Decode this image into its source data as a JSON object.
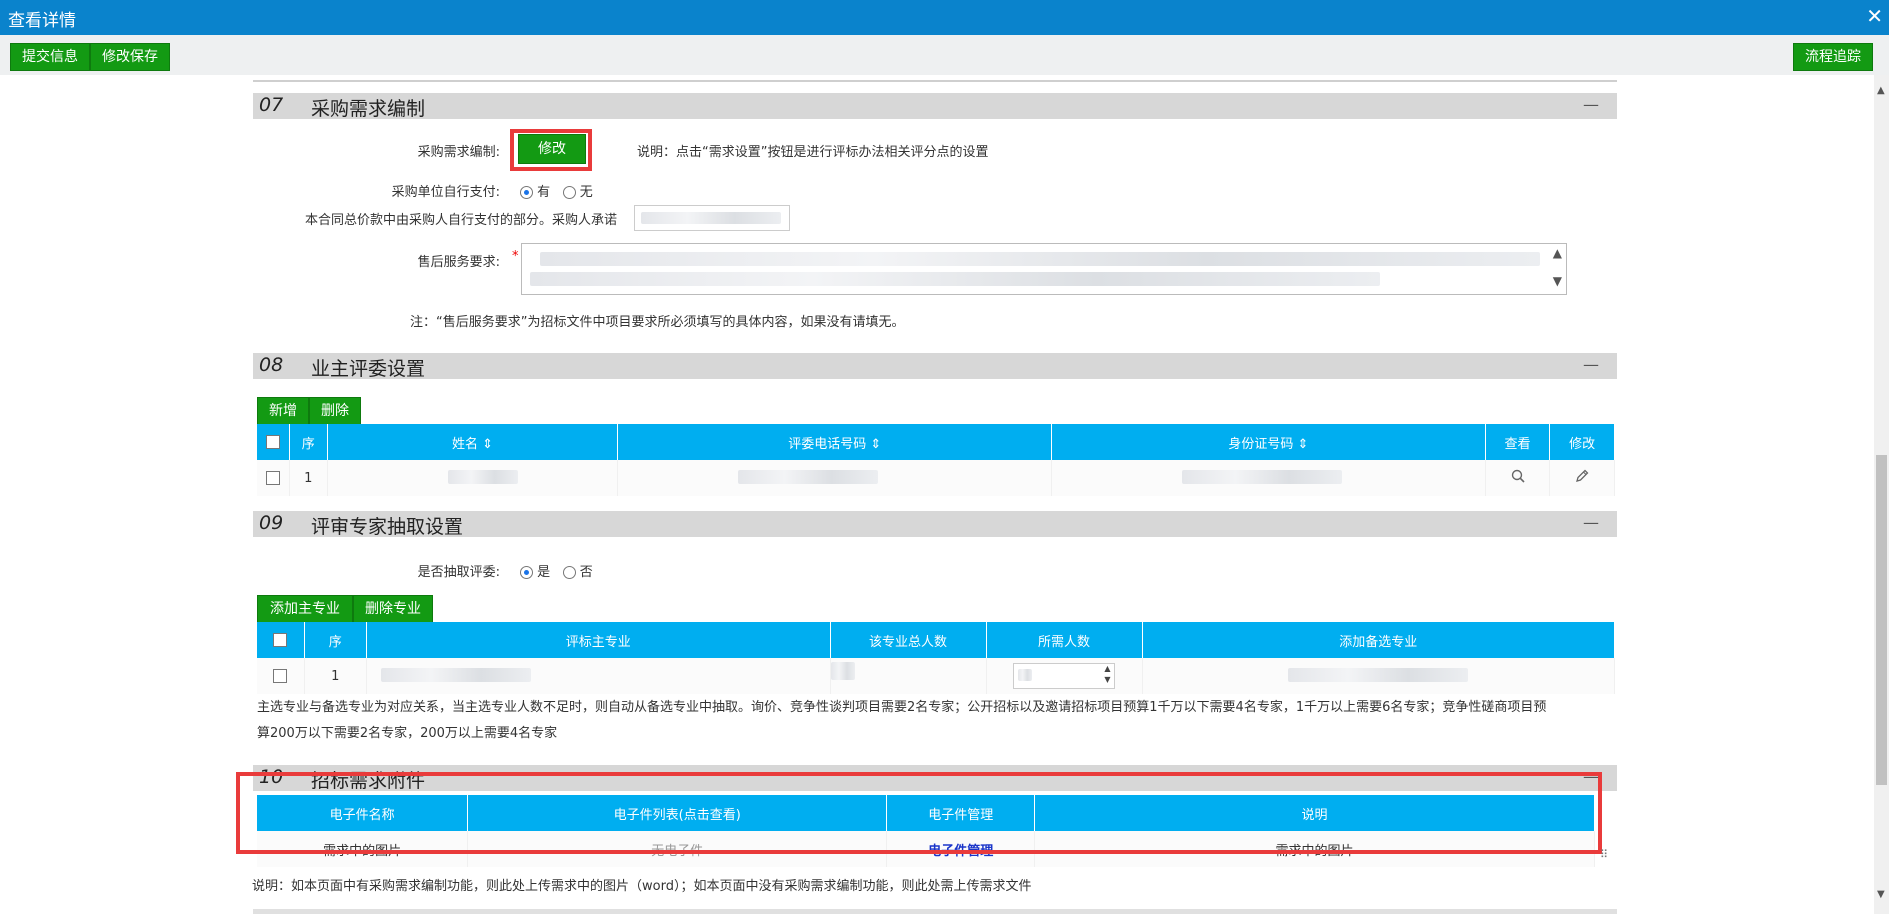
{
  "window": {
    "title": "查看详情"
  },
  "toolbar": {
    "submit": "提交信息",
    "save": "修改保存",
    "trace": "流程追踪"
  },
  "s07": {
    "num": "07",
    "title": "采购需求编制",
    "collapse": "—",
    "edit_label": "采购需求编制:",
    "edit_btn": "修改",
    "edit_note": "说明：点击“需求设置”按钮是进行评标办法相关评分点的设置",
    "self_pay_label": "采购单位自行支付:",
    "yes": "有",
    "no": "无",
    "contract_text": "本合同总价款中由采购人自行支付的部分。采购人承诺",
    "aftersale_label": "售后服务要求:",
    "required_mark": "*",
    "aftersale_note": "注：“售后服务要求”为招标文件中项目要求所必须填写的具体内容，如果没有请填无。"
  },
  "s08": {
    "num": "08",
    "title": "业主评委设置",
    "collapse": "—",
    "add": "新增",
    "del": "删除",
    "headers": [
      "序",
      "姓名 ⇕",
      "评委电话号码 ⇕",
      "身份证号码 ⇕",
      "查看",
      "修改"
    ],
    "row_index": "1"
  },
  "s09": {
    "num": "09",
    "title": "评审专家抽取设置",
    "collapse": "—",
    "draw_label": "是否抽取评委:",
    "yes": "是",
    "no": "否",
    "add": "添加主专业",
    "del": "删除专业",
    "headers": [
      "序",
      "评标主专业",
      "该专业总人数",
      "所需人数",
      "添加备选专业"
    ],
    "row_index": "1",
    "note_line1": "主选专业与备选专业为对应关系，当主选专业人数不足时，则自动从备选专业中抽取。询价、竞争性谈判项目需要2名专家；公开招标以及邀请招标项目预算1千万以下需要4名专家，1千万以上需要6名专家；竞争性磋商项目预",
    "note_line2": "算200万以下需要2名专家，200万以上需要4名专家"
  },
  "s10": {
    "num": "10",
    "title": "招标需求附件",
    "collapse": "—",
    "headers": [
      "电子件名称",
      "电子件列表(点击查看)",
      "电子件管理",
      "说明"
    ],
    "row": {
      "name": "需求中的图片",
      "list": "无电子件",
      "manage": "电子件管理",
      "desc": "需求中的图片"
    },
    "note": "说明：如本页面中有采购需求编制功能，则此处上传需求中的图片（word）；如本页面中没有采购需求编制功能，则此处需上传需求文件"
  },
  "colors": {
    "header_blue": "#00aef0",
    "title_blue": "#0a83cc",
    "button_green": "#139a13",
    "highlight_red": "#e93b3b"
  }
}
